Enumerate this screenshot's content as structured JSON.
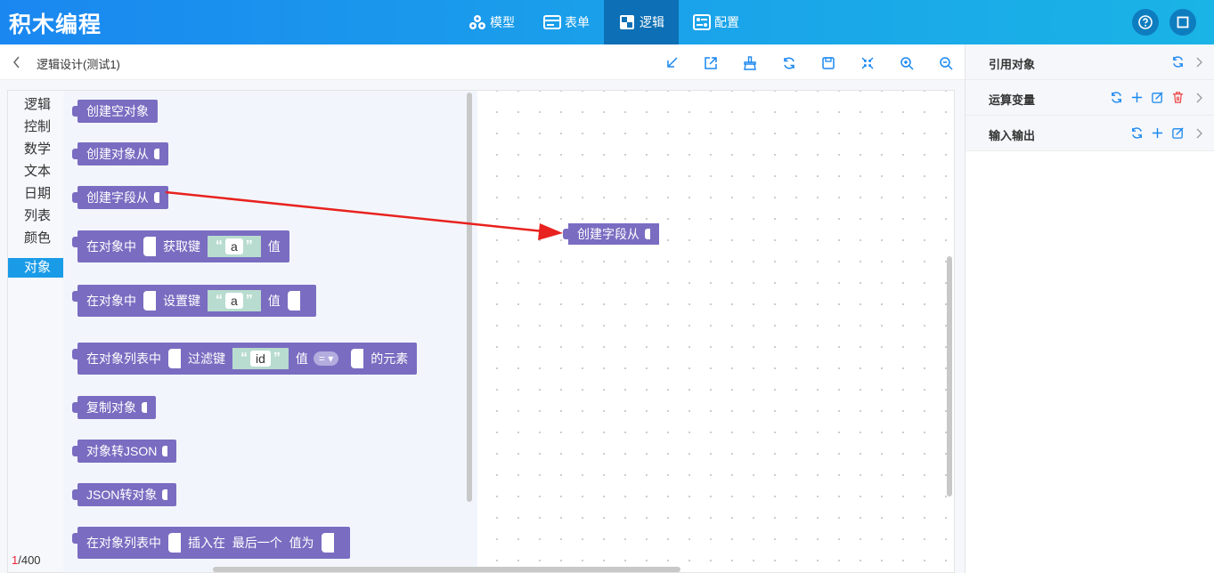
{
  "app": {
    "title": "积木编程"
  },
  "nav": [
    {
      "label": "模型",
      "icon": "model-icon"
    },
    {
      "label": "表单",
      "icon": "form-icon"
    },
    {
      "label": "逻辑",
      "icon": "logic-icon",
      "active": true
    },
    {
      "label": "配置",
      "icon": "config-icon"
    }
  ],
  "header_right": {
    "help_icon": "help-icon",
    "fullscreen_icon": "fullscreen-icon"
  },
  "subheader": {
    "title": "逻辑设计(测试1)"
  },
  "toolbar": [
    "import-icon",
    "export-icon",
    "clean-icon",
    "refresh-icon",
    "save-icon",
    "collapse-icon",
    "zoom-in-icon",
    "zoom-out-icon"
  ],
  "categories": [
    "逻辑",
    "控制",
    "数学",
    "文本",
    "日期",
    "列表",
    "颜色",
    "对象"
  ],
  "active_category": "对象",
  "blocks": {
    "create_empty": "创建空对象",
    "create_from": "创建对象从",
    "create_field": "创建字段从",
    "get_in": "在对象中",
    "get_key": "获取键",
    "get_value": "a",
    "get_suffix": "值",
    "set_in": "在对象中",
    "set_key": "设置键",
    "set_value": "a",
    "set_suffix": "值",
    "filter_in": "在对象列表中",
    "filter_key": "过滤键",
    "filter_value": "id",
    "filter_val": "值",
    "filter_op": "=",
    "filter_suffix": "的元素",
    "copy": "复制对象",
    "to_json": "对象转JSON",
    "from_json": "JSON转对象",
    "insert_in": "在对象列表中",
    "insert_at": "插入在",
    "insert_pos": "最后一个",
    "insert_val": "值为"
  },
  "canvas_block": "创建字段从",
  "counter": {
    "current": "1",
    "total": "/400"
  },
  "colors": {
    "block": "#7a6cc1",
    "string": "#b8dccf",
    "accent": "#1a9be8",
    "arrow": "#e8221e"
  },
  "right_panel": [
    {
      "label": "引用对象",
      "icons": [
        "refresh-icon"
      ]
    },
    {
      "label": "运算变量",
      "icons": [
        "refresh-icon",
        "add-icon",
        "edit-icon",
        "delete-icon"
      ]
    },
    {
      "label": "输入输出",
      "icons": [
        "refresh-icon",
        "add-icon",
        "edit-icon"
      ]
    }
  ]
}
